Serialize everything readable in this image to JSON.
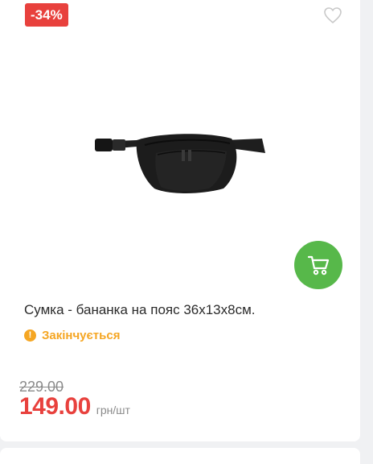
{
  "product": {
    "discount_badge": "-34%",
    "title": "Сумка - бананка на пояс 36х13х8см.",
    "stock_status": "Закінчується",
    "old_price": "229.00",
    "price": "149.00",
    "unit": "грн/шт"
  },
  "icons": {
    "favorite": "heart-outline-icon",
    "cart": "shopping-cart-icon",
    "stock": "exclamation-circle-icon"
  },
  "colors": {
    "badge": "#e8413d",
    "price": "#e8413d",
    "cart_button": "#57b84a",
    "stock_warning": "#f5a623"
  }
}
